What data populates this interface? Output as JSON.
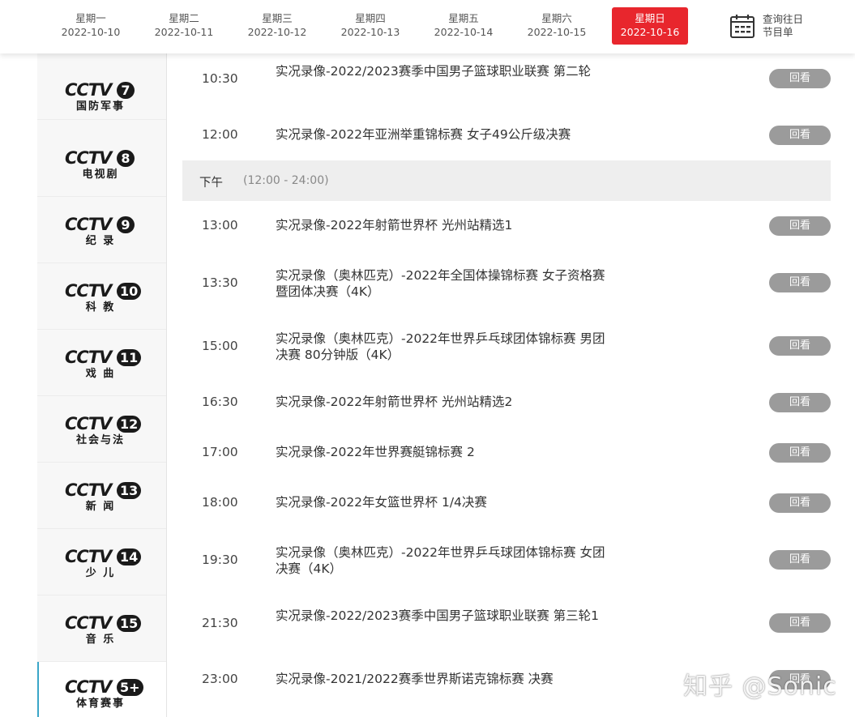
{
  "date_tabs": [
    {
      "weekday": "星期一",
      "date": "2022-10-10"
    },
    {
      "weekday": "星期二",
      "date": "2022-10-11"
    },
    {
      "weekday": "星期三",
      "date": "2022-10-12"
    },
    {
      "weekday": "星期四",
      "date": "2022-10-13"
    },
    {
      "weekday": "星期五",
      "date": "2022-10-14"
    },
    {
      "weekday": "星期六",
      "date": "2022-10-15"
    },
    {
      "weekday": "星期日",
      "date": "2022-10-16",
      "active": true
    }
  ],
  "history": {
    "line1": "查询往日",
    "line2": "节目单",
    "icon": "calendar-icon"
  },
  "colors": {
    "accent": "#e8262d",
    "replay_button": "#9b9b9b",
    "active_channel_border": "#3aa6c8"
  },
  "channels": [
    {
      "brand": "CCTV",
      "num": "7",
      "name": "国防军事"
    },
    {
      "brand": "CCTV",
      "num": "8",
      "name": "电视剧"
    },
    {
      "brand": "CCTV",
      "num": "9",
      "name": "纪 录"
    },
    {
      "brand": "CCTV",
      "num": "10",
      "name": "科 教"
    },
    {
      "brand": "CCTV",
      "num": "11",
      "name": "戏 曲"
    },
    {
      "brand": "CCTV",
      "num": "12",
      "name": "社会与法"
    },
    {
      "brand": "CCTV",
      "num": "13",
      "name": "新 闻"
    },
    {
      "brand": "CCTV",
      "num": "14",
      "name": "少 儿"
    },
    {
      "brand": "CCTV",
      "num": "15",
      "name": "音 乐"
    },
    {
      "brand": "CCTV",
      "num": "5+",
      "name": "体育赛事",
      "active": true
    }
  ],
  "section": {
    "label": "下午",
    "range": "(12:00 - 24:00)"
  },
  "replay_label": "回看",
  "programs": [
    {
      "time": "10:30",
      "title": "实况录像-2022/2023赛季中国男子篮球职业联赛 第二轮"
    },
    {
      "time": "12:00",
      "title": "实况录像-2022年亚洲举重锦标赛 女子49公斤级决赛"
    },
    {
      "time": "13:00",
      "title": "实况录像-2022年射箭世界杯 光州站精选1"
    },
    {
      "time": "13:30",
      "title": "实况录像（奥林匹克）-2022年全国体操锦标赛 女子资格赛暨团体决赛（4K）"
    },
    {
      "time": "15:00",
      "title": "实况录像（奥林匹克）-2022年世界乒乓球团体锦标赛 男团决赛 80分钟版（4K）"
    },
    {
      "time": "16:30",
      "title": "实况录像-2022年射箭世界杯 光州站精选2"
    },
    {
      "time": "17:00",
      "title": "实况录像-2022年世界赛艇锦标赛 2"
    },
    {
      "time": "18:00",
      "title": "实况录像-2022年女篮世界杯 1/4决赛"
    },
    {
      "time": "19:30",
      "title": "实况录像（奥林匹克）-2022年世界乒乓球团体锦标赛 女团决赛（4K）"
    },
    {
      "time": "21:30",
      "title": "实况录像-2022/2023赛季中国男子篮球职业联赛 第三轮1"
    },
    {
      "time": "23:00",
      "title": "实况录像-2021/2022赛季世界斯诺克锦标赛 决赛"
    }
  ],
  "watermark": "知乎 @Sonic"
}
